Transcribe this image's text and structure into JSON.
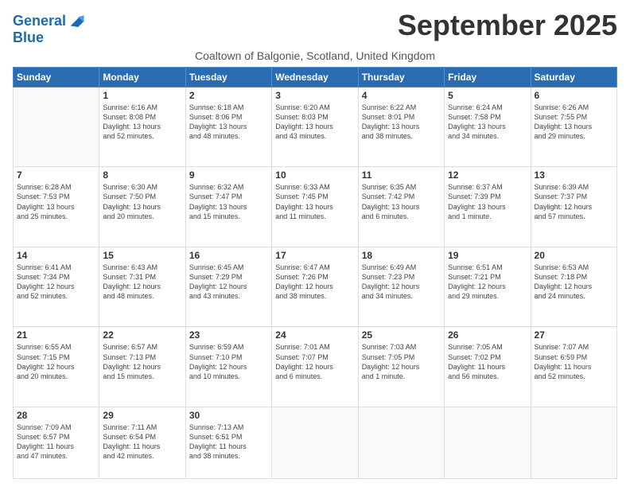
{
  "logo": {
    "line1": "General",
    "line2": "Blue"
  },
  "header": {
    "month": "September 2025",
    "location": "Coaltown of Balgonie, Scotland, United Kingdom"
  },
  "weekdays": [
    "Sunday",
    "Monday",
    "Tuesday",
    "Wednesday",
    "Thursday",
    "Friday",
    "Saturday"
  ],
  "weeks": [
    [
      {
        "day": "",
        "content": ""
      },
      {
        "day": "1",
        "content": "Sunrise: 6:16 AM\nSunset: 8:08 PM\nDaylight: 13 hours\nand 52 minutes."
      },
      {
        "day": "2",
        "content": "Sunrise: 6:18 AM\nSunset: 8:06 PM\nDaylight: 13 hours\nand 48 minutes."
      },
      {
        "day": "3",
        "content": "Sunrise: 6:20 AM\nSunset: 8:03 PM\nDaylight: 13 hours\nand 43 minutes."
      },
      {
        "day": "4",
        "content": "Sunrise: 6:22 AM\nSunset: 8:01 PM\nDaylight: 13 hours\nand 38 minutes."
      },
      {
        "day": "5",
        "content": "Sunrise: 6:24 AM\nSunset: 7:58 PM\nDaylight: 13 hours\nand 34 minutes."
      },
      {
        "day": "6",
        "content": "Sunrise: 6:26 AM\nSunset: 7:55 PM\nDaylight: 13 hours\nand 29 minutes."
      }
    ],
    [
      {
        "day": "7",
        "content": "Sunrise: 6:28 AM\nSunset: 7:53 PM\nDaylight: 13 hours\nand 25 minutes."
      },
      {
        "day": "8",
        "content": "Sunrise: 6:30 AM\nSunset: 7:50 PM\nDaylight: 13 hours\nand 20 minutes."
      },
      {
        "day": "9",
        "content": "Sunrise: 6:32 AM\nSunset: 7:47 PM\nDaylight: 13 hours\nand 15 minutes."
      },
      {
        "day": "10",
        "content": "Sunrise: 6:33 AM\nSunset: 7:45 PM\nDaylight: 13 hours\nand 11 minutes."
      },
      {
        "day": "11",
        "content": "Sunrise: 6:35 AM\nSunset: 7:42 PM\nDaylight: 13 hours\nand 6 minutes."
      },
      {
        "day": "12",
        "content": "Sunrise: 6:37 AM\nSunset: 7:39 PM\nDaylight: 13 hours\nand 1 minute."
      },
      {
        "day": "13",
        "content": "Sunrise: 6:39 AM\nSunset: 7:37 PM\nDaylight: 12 hours\nand 57 minutes."
      }
    ],
    [
      {
        "day": "14",
        "content": "Sunrise: 6:41 AM\nSunset: 7:34 PM\nDaylight: 12 hours\nand 52 minutes."
      },
      {
        "day": "15",
        "content": "Sunrise: 6:43 AM\nSunset: 7:31 PM\nDaylight: 12 hours\nand 48 minutes."
      },
      {
        "day": "16",
        "content": "Sunrise: 6:45 AM\nSunset: 7:29 PM\nDaylight: 12 hours\nand 43 minutes."
      },
      {
        "day": "17",
        "content": "Sunrise: 6:47 AM\nSunset: 7:26 PM\nDaylight: 12 hours\nand 38 minutes."
      },
      {
        "day": "18",
        "content": "Sunrise: 6:49 AM\nSunset: 7:23 PM\nDaylight: 12 hours\nand 34 minutes."
      },
      {
        "day": "19",
        "content": "Sunrise: 6:51 AM\nSunset: 7:21 PM\nDaylight: 12 hours\nand 29 minutes."
      },
      {
        "day": "20",
        "content": "Sunrise: 6:53 AM\nSunset: 7:18 PM\nDaylight: 12 hours\nand 24 minutes."
      }
    ],
    [
      {
        "day": "21",
        "content": "Sunrise: 6:55 AM\nSunset: 7:15 PM\nDaylight: 12 hours\nand 20 minutes."
      },
      {
        "day": "22",
        "content": "Sunrise: 6:57 AM\nSunset: 7:13 PM\nDaylight: 12 hours\nand 15 minutes."
      },
      {
        "day": "23",
        "content": "Sunrise: 6:59 AM\nSunset: 7:10 PM\nDaylight: 12 hours\nand 10 minutes."
      },
      {
        "day": "24",
        "content": "Sunrise: 7:01 AM\nSunset: 7:07 PM\nDaylight: 12 hours\nand 6 minutes."
      },
      {
        "day": "25",
        "content": "Sunrise: 7:03 AM\nSunset: 7:05 PM\nDaylight: 12 hours\nand 1 minute."
      },
      {
        "day": "26",
        "content": "Sunrise: 7:05 AM\nSunset: 7:02 PM\nDaylight: 11 hours\nand 56 minutes."
      },
      {
        "day": "27",
        "content": "Sunrise: 7:07 AM\nSunset: 6:59 PM\nDaylight: 11 hours\nand 52 minutes."
      }
    ],
    [
      {
        "day": "28",
        "content": "Sunrise: 7:09 AM\nSunset: 6:57 PM\nDaylight: 11 hours\nand 47 minutes."
      },
      {
        "day": "29",
        "content": "Sunrise: 7:11 AM\nSunset: 6:54 PM\nDaylight: 11 hours\nand 42 minutes."
      },
      {
        "day": "30",
        "content": "Sunrise: 7:13 AM\nSunset: 6:51 PM\nDaylight: 11 hours\nand 38 minutes."
      },
      {
        "day": "",
        "content": ""
      },
      {
        "day": "",
        "content": ""
      },
      {
        "day": "",
        "content": ""
      },
      {
        "day": "",
        "content": ""
      }
    ]
  ]
}
